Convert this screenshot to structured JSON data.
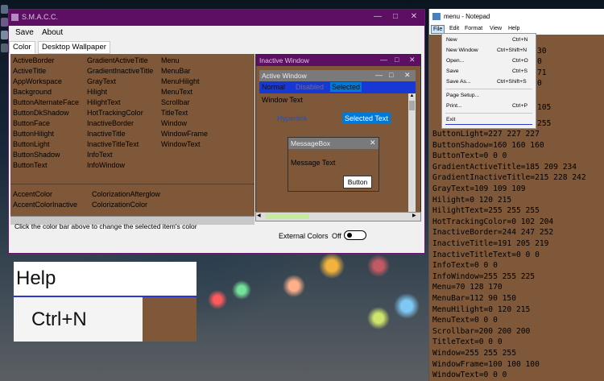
{
  "smacc": {
    "title": "S.M.A.C.C.",
    "menu": [
      "Save",
      "About"
    ],
    "tabs": [
      "Color",
      "Desktop Wallpaper"
    ],
    "color_columns": [
      [
        "ActiveBorder",
        "ActiveTitle",
        "AppWorkspace",
        "Background",
        "ButtonAlternateFace",
        "ButtonDkShadow",
        "ButtonFace",
        "ButtonHilight",
        "ButtonLight",
        "ButtonShadow",
        "ButtonText"
      ],
      [
        "GradientActiveTitle",
        "GradientInactiveTitle",
        "GrayText",
        "Hilight",
        "HilightText",
        "HotTrackingColor",
        "InactiveBorder",
        "InactiveTitle",
        "InactiveTitleText",
        "InfoText",
        "InfoWindow"
      ],
      [
        "Menu",
        "MenuBar",
        "MenuHilight",
        "MenuText",
        "Scrollbar",
        "TitleText",
        "Window",
        "WindowFrame",
        "WindowText"
      ]
    ],
    "accent_col1": [
      "AccentColor",
      "AccentColorInactive"
    ],
    "accent_col2": [
      "ColorizationAfterglow",
      "ColorizationColor"
    ],
    "hint": "Click the color bar above to change the selected item's color",
    "preview": {
      "inactive_title": "Inactive Window",
      "active_title": "Active Window",
      "menu_normal": "Normal",
      "menu_disabled": "Disabled",
      "menu_selected": "Selected",
      "window_text": "Window Text",
      "hyperlink": "Hyperlink",
      "selected_text": "Selected Text",
      "msgbox_title": "MessageBox",
      "msgbox_text": "Message Text",
      "button": "Button"
    },
    "external_colors_label": "External Colors",
    "external_colors_state": "Off"
  },
  "zoom": {
    "menu": "Help",
    "shortcut": "Ctrl+N"
  },
  "notepad": {
    "title": "menu - Notepad",
    "menu": [
      "File",
      "Edit",
      "Format",
      "View",
      "Help"
    ],
    "file_menu": [
      {
        "label": "New",
        "shortcut": "Ctrl+N"
      },
      {
        "label": "New Window",
        "shortcut": "Ctrl+Shift+N"
      },
      {
        "label": "Open...",
        "shortcut": "Ctrl+O"
      },
      {
        "label": "Save",
        "shortcut": "Ctrl+S"
      },
      {
        "label": "Save As...",
        "shortcut": "Ctrl+Shift+S"
      },
      {
        "label": "Page Setup...",
        "shortcut": ""
      },
      {
        "label": "Print...",
        "shortcut": "Ctrl+P"
      },
      {
        "label": "Exit",
        "shortcut": ""
      }
    ],
    "peek_fragments": [
      "30",
      "0",
      "71",
      "0",
      "105",
      "255"
    ],
    "lines": [
      "ButtonLight=227 227 227",
      "ButtonShadow=160 160 160",
      "ButtonText=0 0 0",
      "GradientActiveTitle=185 209 234",
      "GradientInactiveTitle=215 228 242",
      "GrayText=109 109 109",
      "Hilight=0 120 215",
      "HilightText=255 255 255",
      "HotTrackingColor=0 102 204",
      "InactiveBorder=244 247 252",
      "InactiveTitle=191 205 219",
      "InactiveTitleText=0 0 0",
      "InfoText=0 0 0",
      "InfoWindow=255 255 225",
      "Menu=70 128 170",
      "MenuBar=112 90 150",
      "MenuHilight=0 120 215",
      "MenuText=0 0 0",
      "Scrollbar=200 200 200",
      "TitleText=0 0 0",
      "Window=255 255 255",
      "WindowFrame=100 100 100",
      "WindowText=0 0 0"
    ]
  },
  "colors": {
    "title_purple": "#5d0f64",
    "brown_swatch": "#7e5838",
    "menu_blue": "#1838d6",
    "selected_blue": "#0078d7"
  }
}
